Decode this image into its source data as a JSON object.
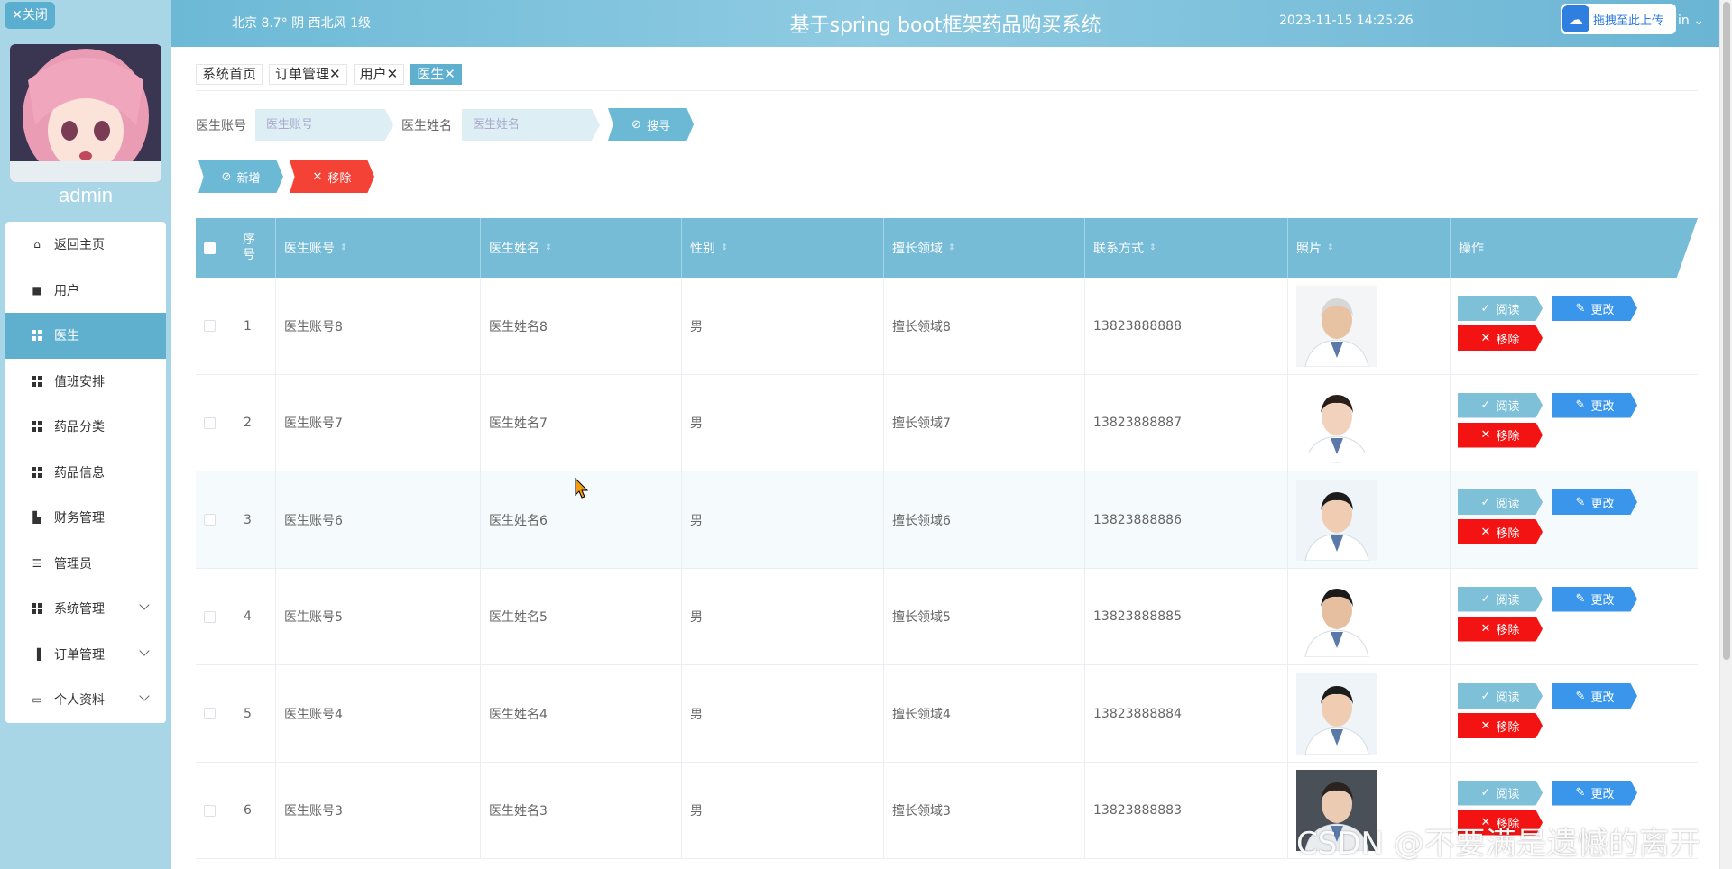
{
  "sidebar": {
    "close_label": "✕关闭",
    "username": "admin",
    "items": [
      {
        "label": "返回主页",
        "icon": "home-icon"
      },
      {
        "label": "用户",
        "icon": "user-icon"
      },
      {
        "label": "医生",
        "icon": "grid-icon",
        "active": true
      },
      {
        "label": "值班安排",
        "icon": "grid-icon"
      },
      {
        "label": "药品分类",
        "icon": "grid-icon"
      },
      {
        "label": "药品信息",
        "icon": "grid-icon"
      },
      {
        "label": "财务管理",
        "icon": "finance-icon"
      },
      {
        "label": "管理员",
        "icon": "list-icon"
      },
      {
        "label": "系统管理",
        "icon": "grid-icon",
        "expandable": true
      },
      {
        "label": "订单管理",
        "icon": "chart-icon",
        "expandable": true
      },
      {
        "label": "个人资料",
        "icon": "card-icon",
        "expandable": true
      }
    ]
  },
  "header": {
    "weather": "北京  8.7°  阴  西北风  1级",
    "title": "基于spring boot框架药品购买系统",
    "datetime": "2023-11-15 14:25:26",
    "upload_label": "拖拽至此上传",
    "user_label": "in"
  },
  "tabs": [
    {
      "label": "系统首页",
      "closable": false
    },
    {
      "label": "订单管理",
      "closable": true
    },
    {
      "label": "用户",
      "closable": true
    },
    {
      "label": "医生",
      "closable": true,
      "active": true
    }
  ],
  "search": {
    "account_label": "医生账号",
    "account_placeholder": "医生账号",
    "name_label": "医生姓名",
    "name_placeholder": "医生姓名",
    "search_button": "搜寻"
  },
  "actions": {
    "add": "新增",
    "remove": "移除"
  },
  "table": {
    "columns": [
      "序号",
      "医生账号",
      "医生姓名",
      "性别",
      "擅长领域",
      "联系方式",
      "照片",
      "操作"
    ],
    "rows": [
      {
        "index": "1",
        "account": "医生账号8",
        "name": "医生姓名8",
        "gender": "男",
        "field": "擅长领域8",
        "phone": "13823888888"
      },
      {
        "index": "2",
        "account": "医生账号7",
        "name": "医生姓名7",
        "gender": "男",
        "field": "擅长领域7",
        "phone": "13823888887"
      },
      {
        "index": "3",
        "account": "医生账号6",
        "name": "医生姓名6",
        "gender": "男",
        "field": "擅长领域6",
        "phone": "13823888886"
      },
      {
        "index": "4",
        "account": "医生账号5",
        "name": "医生姓名5",
        "gender": "男",
        "field": "擅长领域5",
        "phone": "13823888885"
      },
      {
        "index": "5",
        "account": "医生账号4",
        "name": "医生姓名4",
        "gender": "男",
        "field": "擅长领域4",
        "phone": "13823888884"
      },
      {
        "index": "6",
        "account": "医生账号3",
        "name": "医生姓名3",
        "gender": "男",
        "field": "擅长领域3",
        "phone": "13823888883"
      }
    ],
    "row_actions": {
      "read": "阅读",
      "edit": "更改",
      "delete": "移除"
    }
  },
  "watermark": "CSDN @不要满是遗憾的离开"
}
